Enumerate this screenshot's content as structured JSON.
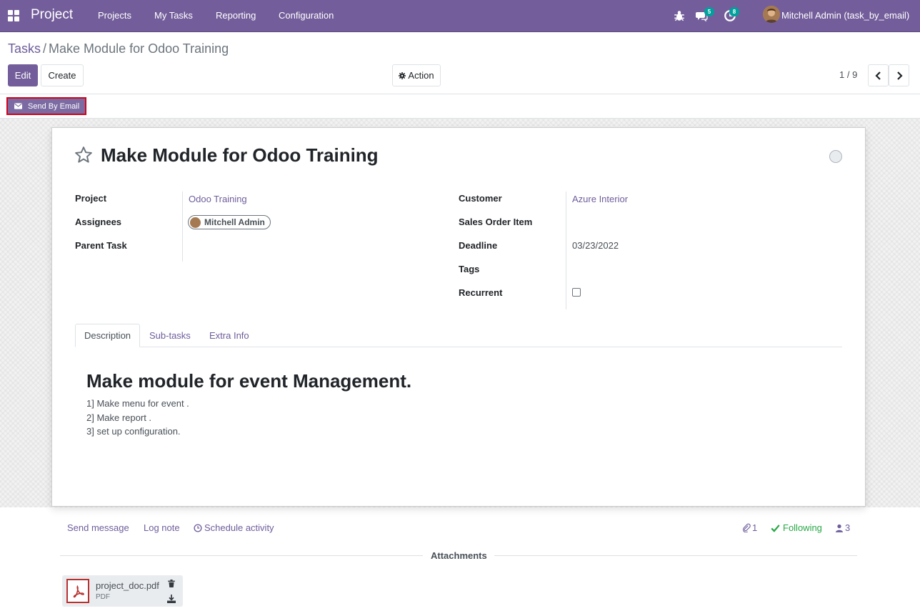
{
  "navbar": {
    "brand": "Project",
    "menu": [
      "Projects",
      "My Tasks",
      "Reporting",
      "Configuration"
    ],
    "messages_badge": "5",
    "activities_badge": "8",
    "user": "Mitchell Admin (task_by_email)"
  },
  "breadcrumb": {
    "parent": "Tasks",
    "separator": "/",
    "current": "Make Module for Odoo Training"
  },
  "controls": {
    "edit": "Edit",
    "create": "Create",
    "action": "Action",
    "pager": "1 / 9"
  },
  "statusbar": {
    "send_email": "Send By Email"
  },
  "task": {
    "title": "Make Module for Odoo Training",
    "left_fields": [
      {
        "label": "Project",
        "value": "Odoo Training"
      },
      {
        "label": "Assignees",
        "value": "Mitchell Admin"
      },
      {
        "label": "Parent Task",
        "value": ""
      }
    ],
    "right_fields": [
      {
        "label": "Customer",
        "value": "Azure Interior"
      },
      {
        "label": "Sales Order Item",
        "value": ""
      },
      {
        "label": "Deadline",
        "value": "03/23/2022"
      },
      {
        "label": "Tags",
        "value": ""
      },
      {
        "label": "Recurrent",
        "value": ""
      }
    ],
    "recurrent": false
  },
  "tabs": [
    "Description",
    "Sub-tasks",
    "Extra Info"
  ],
  "description": {
    "heading": "Make module for event Management.",
    "lines": [
      "1] Make menu for event .",
      "2] Make report .",
      "3] set up configuration."
    ]
  },
  "chatter": {
    "send_message": "Send message",
    "log_note": "Log note",
    "schedule_activity": "Schedule activity",
    "attachments_count": "1",
    "following": "Following",
    "followers_count": "3",
    "attachments_title": "Attachments",
    "attachment": {
      "name": "project_doc.pdf",
      "type": "PDF"
    }
  },
  "colors": {
    "brand": "#735e9b",
    "link": "#6f5d9b",
    "following": "#28a745",
    "highlight": "#d0021b"
  }
}
